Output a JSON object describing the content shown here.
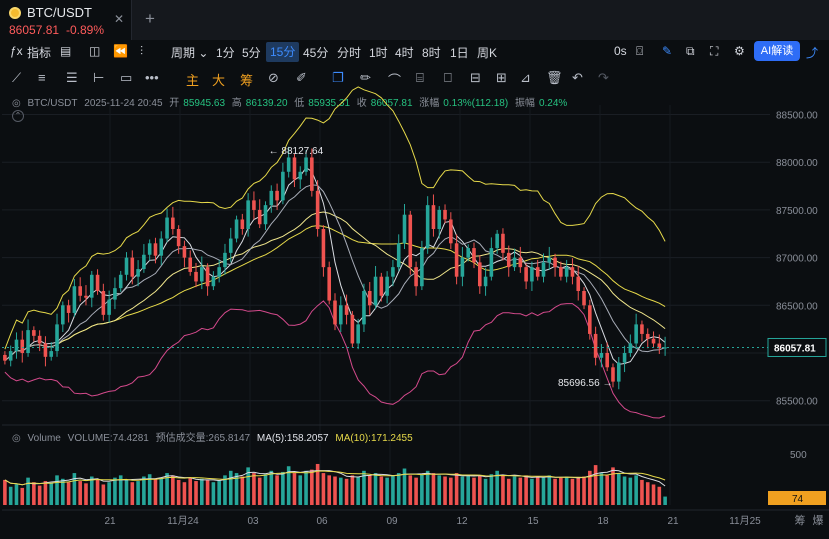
{
  "tab": {
    "symbol": "BTC/USDT",
    "price": "86057.81",
    "change": "-0.89%",
    "close_icon": "close-icon"
  },
  "newtab": {
    "label": "+"
  },
  "toolbar": {
    "indicator_label": "指标",
    "period_label": "周期",
    "intervals": [
      "1分",
      "5分",
      "15分",
      "45分",
      "分时",
      "1时",
      "4时",
      "8时",
      "1日",
      "周K"
    ],
    "selected_interval": "15分",
    "replay_label": "0s",
    "ai_label": "AI解读"
  },
  "drawbar": {
    "main_label": "主",
    "big_label": "大",
    "chip_label": "筹"
  },
  "header": {
    "pair": "BTC/USDT",
    "datetime": "2025-11-24 20:45",
    "open_label": "开",
    "open": "85945.63",
    "high_label": "高",
    "high": "86139.20",
    "low_label": "低",
    "low": "85935.31",
    "close_label": "收",
    "close": "86057.81",
    "change_label": "涨幅",
    "change": "0.13%(112.18)",
    "amp_label": "振幅",
    "amp": "0.24%"
  },
  "volume_header": {
    "title": "Volume",
    "volume": "VOLUME:74.4281",
    "estimate": "预估成交量:265.8147",
    "ma5": "MA(5):158.2057",
    "ma10": "MA(10):171.2455"
  },
  "colors": {
    "up": "#26a69a",
    "down": "#ef5350",
    "accent": "#2e6df6",
    "yellow": "#e6d94a",
    "pink": "#d44a8c",
    "white_ma": "#d9dce2"
  },
  "chart_data": {
    "type": "candlestick",
    "y_ticks": [
      88500,
      88000,
      87500,
      87000,
      86500,
      86000,
      85500
    ],
    "y_tick_labels": [
      "88500.00",
      "88000.00",
      "87500.00",
      "87000.00",
      "86500.00",
      "86000.00",
      "85500.00"
    ],
    "ylim": [
      85350,
      88600
    ],
    "current_price": 86057.81,
    "current_price_label": "86057.81",
    "high_annotation": {
      "value": 88127.64,
      "label": "88127.64"
    },
    "low_annotation": {
      "value": 85696.56,
      "label": "85696.56"
    },
    "x_tick_labels": [
      "21",
      "11月24",
      "03",
      "06",
      "09",
      "12",
      "15",
      "18",
      "21",
      "11月25"
    ],
    "volume_tick_label": "500",
    "volume_value_label": "74",
    "corner_labels": [
      "筹",
      "爆"
    ],
    "closes": [
      85920,
      86020,
      86140,
      86000,
      86240,
      86180,
      86100,
      85960,
      86020,
      86300,
      86500,
      86420,
      86700,
      86600,
      86580,
      86820,
      86650,
      86400,
      86560,
      86680,
      86820,
      87000,
      86800,
      86880,
      87030,
      87150,
      87020,
      87200,
      87420,
      87300,
      87120,
      87000,
      86850,
      86750,
      86900,
      86700,
      86800,
      86900,
      87050,
      87200,
      87400,
      87300,
      87600,
      87500,
      87350,
      87550,
      87700,
      87600,
      87900,
      88050,
      87820,
      87900,
      88050,
      87700,
      87300,
      86900,
      86550,
      86300,
      86500,
      86400,
      86100,
      86300,
      86650,
      86500,
      86800,
      86600,
      86800,
      86900,
      87150,
      87450,
      86900,
      86700,
      87100,
      87550,
      87300,
      87500,
      87400,
      87150,
      86800,
      87000,
      87100,
      86950,
      86700,
      86800,
      87100,
      87250,
      87050,
      86900,
      87000,
      86900,
      86750,
      86900,
      86800,
      86950,
      87000,
      86900,
      86800,
      86900,
      86800,
      86650,
      86500,
      86200,
      85950,
      86000,
      85850,
      85700,
      85900,
      86000,
      86100,
      86300,
      86200,
      86150,
      86100,
      86050,
      86058
    ],
    "volumes": [
      220,
      160,
      180,
      150,
      240,
      200,
      170,
      210,
      190,
      260,
      230,
      200,
      280,
      210,
      190,
      250,
      220,
      180,
      200,
      240,
      260,
      220,
      200,
      210,
      250,
      270,
      230,
      240,
      280,
      260,
      220,
      200,
      240,
      210,
      230,
      220,
      200,
      210,
      260,
      300,
      280,
      250,
      330,
      280,
      240,
      270,
      300,
      260,
      290,
      340,
      280,
      260,
      300,
      310,
      360,
      280,
      260,
      250,
      240,
      230,
      260,
      250,
      300,
      260,
      280,
      250,
      240,
      260,
      280,
      320,
      260,
      240,
      270,
      300,
      280,
      260,
      250,
      240,
      280,
      250,
      260,
      240,
      260,
      230,
      270,
      300,
      260,
      230,
      250,
      240,
      260,
      230,
      250,
      240,
      260,
      230,
      240,
      250,
      230,
      240,
      250,
      300,
      350,
      280,
      260,
      330,
      280,
      250,
      240,
      260,
      220,
      200,
      180,
      160,
      74
    ]
  }
}
